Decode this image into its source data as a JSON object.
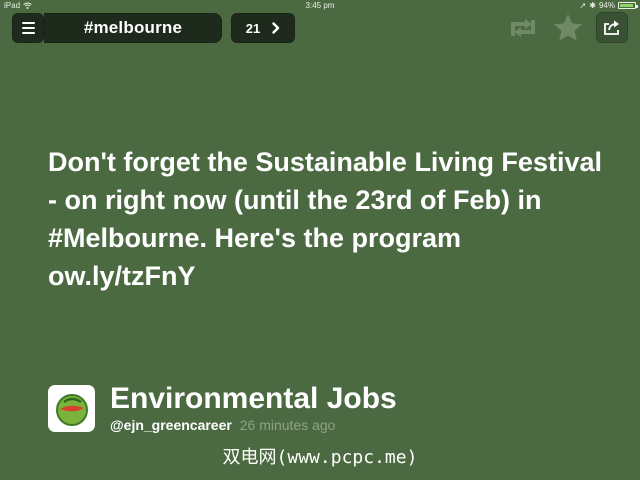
{
  "status_bar": {
    "device": "iPad",
    "time": "3:45 pm",
    "battery": "94%",
    "battery_level": 0.94,
    "bluetooth_symbol": "✱",
    "location_symbol": "➚"
  },
  "nav": {
    "title": "#melbourne",
    "count": "21"
  },
  "tweet": {
    "text": "Don't forget the Sustainable Living Festival - on right now (until the 23rd of Feb) in #Melbourne. Here's the program ow.ly/tzFnY"
  },
  "author": {
    "name": "Environmental Jobs",
    "handle": "@ejn_greencareer",
    "time": "26 minutes ago"
  },
  "watermark": "双电网(www.pcpc.me)",
  "colors": {
    "background": "#4b6a41",
    "toolbar_dark": "#1e2a1b",
    "inactive_icon": "#6f8a64",
    "timestamp": "#8ea385"
  },
  "icons": [
    "hamburger-icon",
    "chevron-right-icon",
    "retweet-icon",
    "star-icon",
    "share-icon",
    "wifi-icon",
    "battery-icon",
    "avatar-logo-icon"
  ]
}
